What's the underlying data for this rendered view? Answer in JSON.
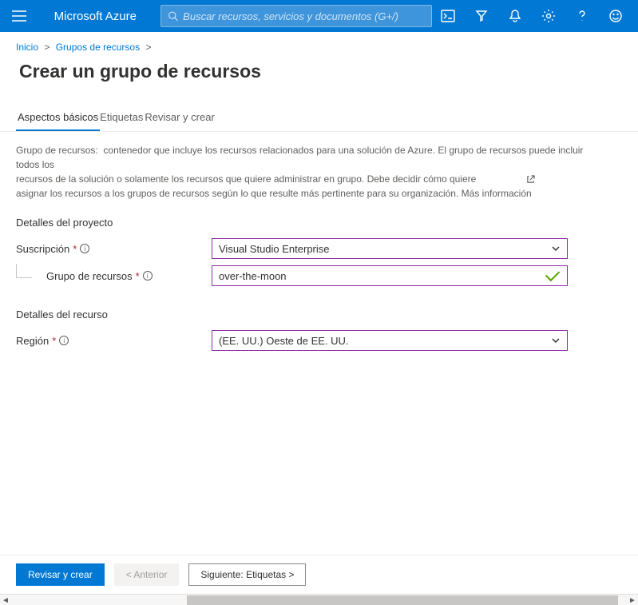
{
  "header": {
    "brand": "Microsoft Azure",
    "search_placeholder": "Buscar recursos, servicios y documentos (G+/)"
  },
  "breadcrumb": {
    "home": "Inicio",
    "group": "Grupos de recursos"
  },
  "page_title": "Crear un grupo de recursos",
  "tabs": {
    "basics": "Aspectos básicos",
    "tags": "Etiquetas",
    "review": "Revisar y crear"
  },
  "description": {
    "l1_a": "Grupo de recursos:",
    "l1_b": "contenedor que incluye los recursos relacionados para una solución de Azure. El grupo de recursos puede incluir todos los",
    "l2": "recursos de la solución o solamente los recursos que quiere administrar en grupo. Debe decidir cómo quiere",
    "l3": "asignar los recursos a los grupos de recursos según lo que resulte más pertinente para su organización. Más información"
  },
  "project_section": "Detalles del proyecto",
  "subscription": {
    "label": "Suscripción",
    "value": "Visual Studio Enterprise"
  },
  "resource_group": {
    "label": "Grupo de recursos",
    "value": "over-the-moon"
  },
  "resource_section": "Detalles del recurso",
  "region": {
    "label": "Región",
    "value": "(EE. UU.) Oeste de EE. UU."
  },
  "footer": {
    "review": "Revisar y crear",
    "previous": "< Anterior",
    "next": "Siguiente: Etiquetas >"
  }
}
